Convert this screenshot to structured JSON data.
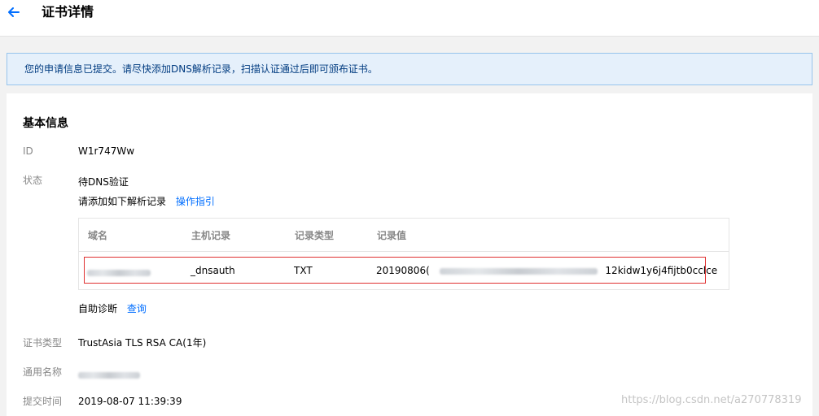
{
  "header": {
    "title": "证书详情",
    "back_icon": "arrow-left-icon"
  },
  "notice": {
    "text": "您的申请信息已提交。请尽快添加DNS解析记录，扫描认证通过后即可颁布证书。"
  },
  "basic_info": {
    "section_title": "基本信息",
    "id_label": "ID",
    "id_value": "W1r747Ww",
    "status_label": "状态",
    "status_value": "待DNS验证",
    "add_record_hint": "请添加如下解析记录",
    "guide_link": "操作指引",
    "dns_table": {
      "columns": [
        "域名",
        "主机记录",
        "记录类型",
        "记录值"
      ],
      "row": {
        "domain": "",
        "host": "_dnsauth",
        "type": "TXT",
        "value_prefix": "20190806(",
        "value_suffix": "12kidw1y6j4fijtb0cclce"
      }
    },
    "self_diagnose_label": "自助诊断",
    "query_link": "查询",
    "cert_type_label": "证书类型",
    "cert_type_value": "TrustAsia TLS RSA CA(1年)",
    "common_name_label": "通用名称",
    "submit_time_label": "提交时间",
    "submit_time_value": "2019-08-07 11:39:39"
  },
  "watermark": "https://blog.csdn.net/a270778319",
  "colors": {
    "accent": "#006eff",
    "highlight_border": "#e03131",
    "notice_bg": "#e5f0fb"
  }
}
